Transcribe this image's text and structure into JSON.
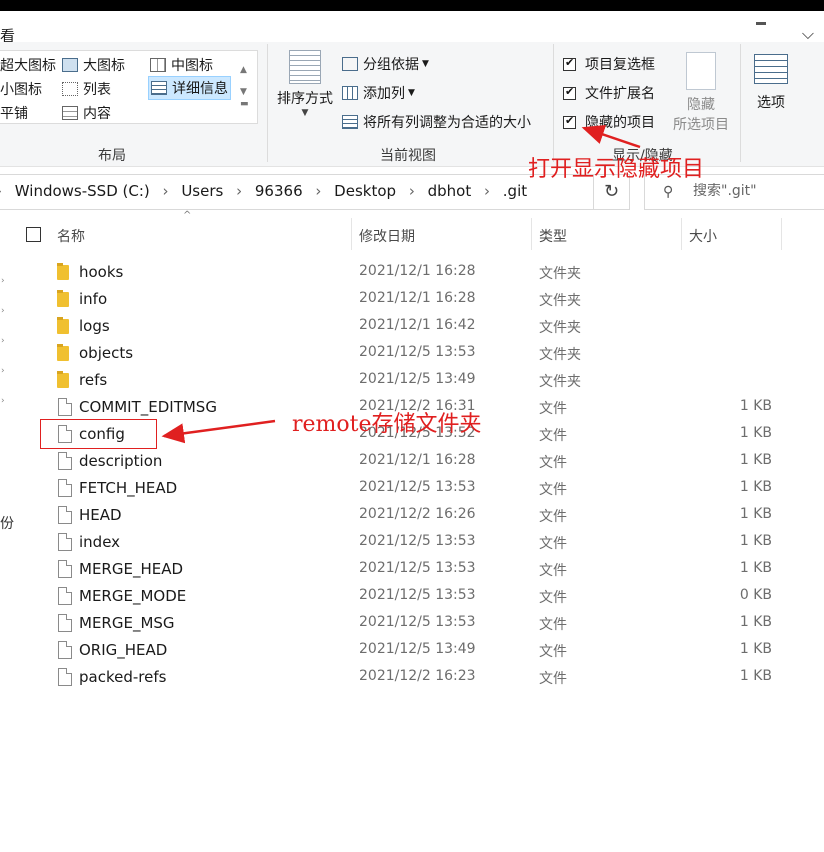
{
  "ribbon": {
    "tab_view": "看",
    "layout": {
      "label": "布局",
      "items": [
        "超大图标",
        "大图标",
        "中图标",
        "小图标",
        "列表",
        "详细信息",
        "平铺",
        "内容"
      ],
      "selected": "详细信息"
    },
    "current_view": {
      "label": "当前视图",
      "sort_by": "排序方式",
      "group_by": "分组依据",
      "add_column": "添加列",
      "fit_columns": "将所有列调整为合适的大小"
    },
    "show_hide": {
      "label": "显示/隐藏",
      "item_checkboxes": "项目复选框",
      "file_extensions": "文件扩展名",
      "hidden_items": "隐藏的项目",
      "hide_selected_line1": "隐藏",
      "hide_selected_line2": "所选项目"
    },
    "options": "选项"
  },
  "address": {
    "crumbs": [
      "Windows-SSD (C:)",
      "Users",
      "96366",
      "Desktop",
      "dbhot",
      ".git"
    ],
    "search_placeholder": "搜索\".git\""
  },
  "columns": {
    "name": "名称",
    "date": "修改日期",
    "type": "类型",
    "size": "大小"
  },
  "files": [
    {
      "name": "hooks",
      "date": "2021/12/1 16:28",
      "type": "文件夹",
      "size": "",
      "kind": "folder"
    },
    {
      "name": "info",
      "date": "2021/12/1 16:28",
      "type": "文件夹",
      "size": "",
      "kind": "folder"
    },
    {
      "name": "logs",
      "date": "2021/12/1 16:42",
      "type": "文件夹",
      "size": "",
      "kind": "folder"
    },
    {
      "name": "objects",
      "date": "2021/12/5 13:53",
      "type": "文件夹",
      "size": "",
      "kind": "folder"
    },
    {
      "name": "refs",
      "date": "2021/12/5 13:49",
      "type": "文件夹",
      "size": "",
      "kind": "folder"
    },
    {
      "name": "COMMIT_EDITMSG",
      "date": "2021/12/2 16:31",
      "type": "文件",
      "size": "1 KB",
      "kind": "file"
    },
    {
      "name": "config",
      "date": "2021/12/5 13:52",
      "type": "文件",
      "size": "1 KB",
      "kind": "file"
    },
    {
      "name": "description",
      "date": "2021/12/1 16:28",
      "type": "文件",
      "size": "1 KB",
      "kind": "file"
    },
    {
      "name": "FETCH_HEAD",
      "date": "2021/12/5 13:53",
      "type": "文件",
      "size": "1 KB",
      "kind": "file"
    },
    {
      "name": "HEAD",
      "date": "2021/12/2 16:26",
      "type": "文件",
      "size": "1 KB",
      "kind": "file"
    },
    {
      "name": "index",
      "date": "2021/12/5 13:53",
      "type": "文件",
      "size": "1 KB",
      "kind": "file"
    },
    {
      "name": "MERGE_HEAD",
      "date": "2021/12/5 13:53",
      "type": "文件",
      "size": "1 KB",
      "kind": "file"
    },
    {
      "name": "MERGE_MODE",
      "date": "2021/12/5 13:53",
      "type": "文件",
      "size": "0 KB",
      "kind": "file"
    },
    {
      "name": "MERGE_MSG",
      "date": "2021/12/5 13:53",
      "type": "文件",
      "size": "1 KB",
      "kind": "file"
    },
    {
      "name": "ORIG_HEAD",
      "date": "2021/12/5 13:49",
      "type": "文件",
      "size": "1 KB",
      "kind": "file"
    },
    {
      "name": "packed-refs",
      "date": "2021/12/2 16:23",
      "type": "文件",
      "size": "1 KB",
      "kind": "file"
    }
  ],
  "nav_fragment": "份",
  "annotations": {
    "show_hidden": "打开显示隐藏项目",
    "remote_config": "remote存储文件夹",
    "color": "#e02020"
  }
}
